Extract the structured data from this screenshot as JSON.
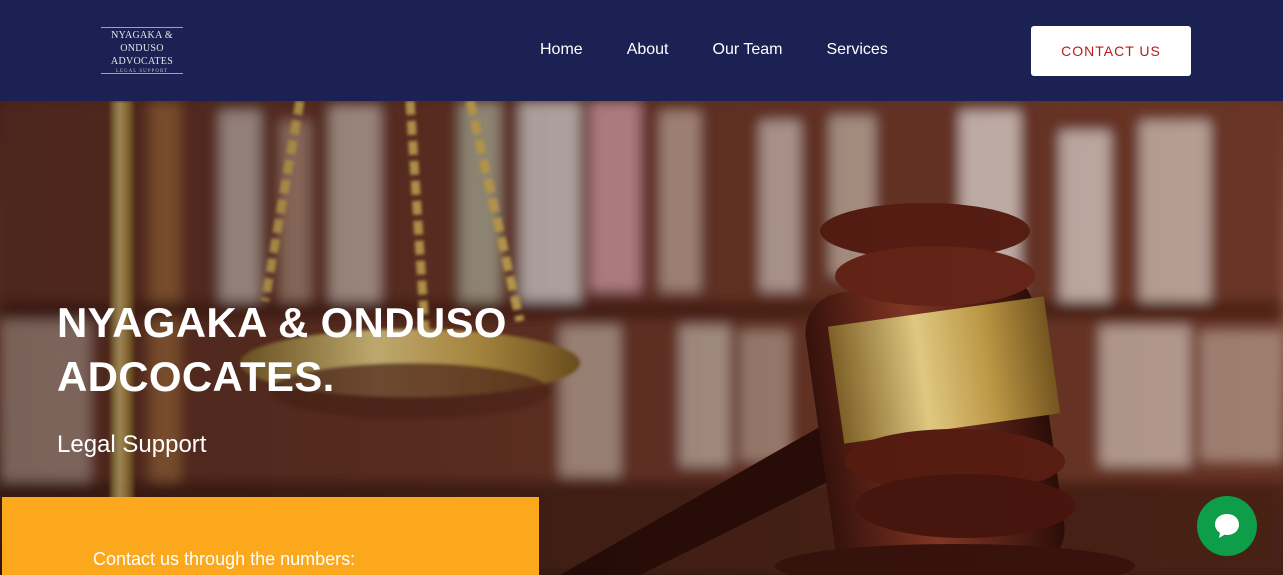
{
  "logo": {
    "line1": "NYAGAKA &",
    "line2": "ONDUSO",
    "line3": "ADVOCATES",
    "tagline": "LEGAL SUPPORT"
  },
  "nav": {
    "items": [
      {
        "label": "Home"
      },
      {
        "label": "About"
      },
      {
        "label": "Our Team"
      },
      {
        "label": "Services"
      }
    ],
    "contact_label": "CONTACT US"
  },
  "hero": {
    "title": "NYAGAKA & ONDUSO ADCOCATES.",
    "subtitle": "Legal Support"
  },
  "contact_box": {
    "text": "Contact us through the numbers:"
  },
  "colors": {
    "navbar": "#1b2152",
    "accent_orange": "#fca81c",
    "contact_text_red": "#b81c1c",
    "chat_green": "#0e9d48"
  },
  "icons": {
    "chat": "chat-bubble-icon"
  }
}
